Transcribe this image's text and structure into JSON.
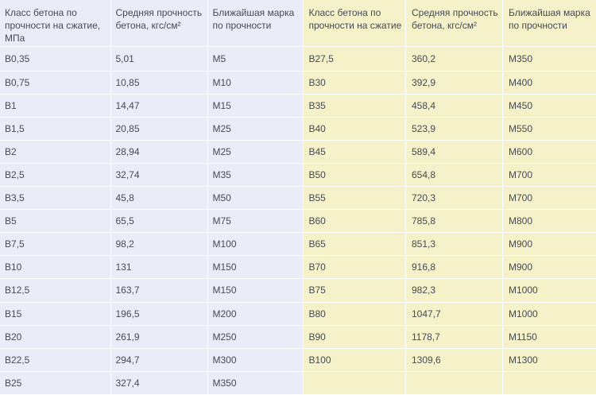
{
  "headers": {
    "class": "Класс бетона по прочности на сжатие, МПа",
    "strength": "Средняя прочность бетона, кгс/см²",
    "grade": "Ближайшая марка по прочности",
    "class_right": "Класс бетона по прочности на сжатие"
  },
  "left_rows": [
    {
      "cls": "B0,35",
      "strength": "5,01",
      "grade": "M5"
    },
    {
      "cls": "B0,75",
      "strength": "10,85",
      "grade": "M10"
    },
    {
      "cls": "B1",
      "strength": "14,47",
      "grade": "M15"
    },
    {
      "cls": "B1,5",
      "strength": "20,85",
      "grade": "M25"
    },
    {
      "cls": "B2",
      "strength": "28,94",
      "grade": "M25"
    },
    {
      "cls": "B2,5",
      "strength": "32,74",
      "grade": "M35"
    },
    {
      "cls": "B3,5",
      "strength": "45,8",
      "grade": "M50"
    },
    {
      "cls": "B5",
      "strength": "65,5",
      "grade": "M75"
    },
    {
      "cls": "B7,5",
      "strength": "98,2",
      "grade": "M100"
    },
    {
      "cls": "B10",
      "strength": "131",
      "grade": "M150"
    },
    {
      "cls": "B12,5",
      "strength": "163,7",
      "grade": "M150"
    },
    {
      "cls": "B15",
      "strength": "196,5",
      "grade": "M200"
    },
    {
      "cls": "B20",
      "strength": "261,9",
      "grade": "M250"
    },
    {
      "cls": "B22,5",
      "strength": "294,7",
      "grade": "M300"
    },
    {
      "cls": "B25",
      "strength": "327,4",
      "grade": "M350"
    }
  ],
  "right_rows": [
    {
      "cls": "B27,5",
      "strength": "360,2",
      "grade": "M350"
    },
    {
      "cls": "B30",
      "strength": "392,9",
      "grade": "M400"
    },
    {
      "cls": "B35",
      "strength": "458,4",
      "grade": "M450"
    },
    {
      "cls": "B40",
      "strength": "523,9",
      "grade": "M550"
    },
    {
      "cls": "B45",
      "strength": "589,4",
      "grade": "M600"
    },
    {
      "cls": "B50",
      "strength": "654,8",
      "grade": "M700"
    },
    {
      "cls": "B55",
      "strength": "720,3",
      "grade": "M700"
    },
    {
      "cls": "B60",
      "strength": "785,8",
      "grade": "M800"
    },
    {
      "cls": "B65",
      "strength": "851,3",
      "grade": "M900"
    },
    {
      "cls": "B70",
      "strength": "916,8",
      "grade": "M900"
    },
    {
      "cls": "B75",
      "strength": "982,3",
      "grade": "M1000"
    },
    {
      "cls": "B80",
      "strength": "1047,7",
      "grade": "M1000"
    },
    {
      "cls": "B90",
      "strength": "1178,7",
      "grade": "M1150"
    },
    {
      "cls": "B100",
      "strength": "1309,6",
      "grade": "M1300"
    },
    {
      "cls": "",
      "strength": "",
      "grade": ""
    }
  ],
  "colors": {
    "left_background": "#eaedf8",
    "right_background": "#f5f1c8",
    "text": "#444a55",
    "grid_lines": "#ffffff"
  }
}
